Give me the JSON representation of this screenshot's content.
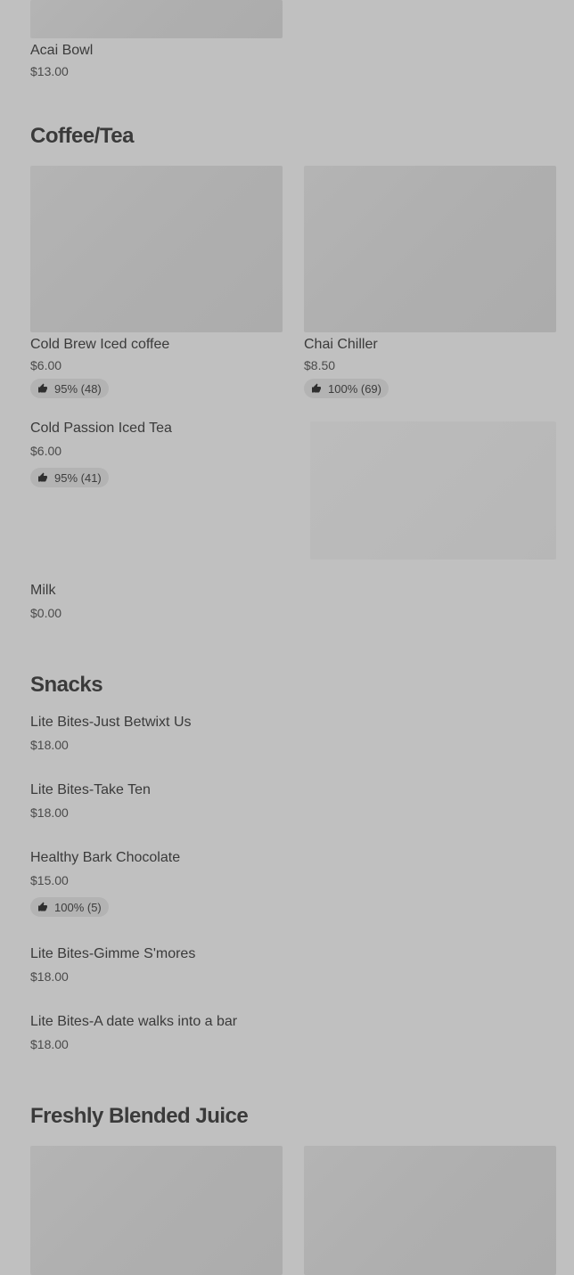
{
  "sections": {
    "top": {
      "item": {
        "name": "Acai Bowl",
        "price": "$13.00"
      }
    },
    "coffee_tea": {
      "title": "Coffee/Tea",
      "items": [
        {
          "name": "Cold Brew Iced coffee",
          "price": "$6.00",
          "rating": "95% (48)"
        },
        {
          "name": "Chai Chiller",
          "price": "$8.50",
          "rating": "100% (69)"
        },
        {
          "name": "Cold Passion Iced Tea",
          "price": "$6.00",
          "rating": "95% (41)"
        },
        {
          "name": "Milk",
          "price": "$0.00"
        }
      ]
    },
    "snacks": {
      "title": "Snacks",
      "items": [
        {
          "name": "Lite Bites-Just Betwixt Us",
          "price": "$18.00"
        },
        {
          "name": "Lite Bites-Take Ten",
          "price": "$18.00"
        },
        {
          "name": "Healthy Bark Chocolate",
          "price": "$15.00",
          "rating": "100% (5)"
        },
        {
          "name": "Lite Bites-Gimme S'mores",
          "price": "$18.00"
        },
        {
          "name": "Lite Bites-A date walks into a bar",
          "price": "$18.00"
        }
      ]
    },
    "juice": {
      "title": "Freshly Blended Juice"
    }
  },
  "icons": {
    "rating": "thumbs-up-icon"
  },
  "colors": {
    "background": "#c0c0c0",
    "placeholder": "#b0b0b0",
    "badge": "#b3b3b3"
  }
}
